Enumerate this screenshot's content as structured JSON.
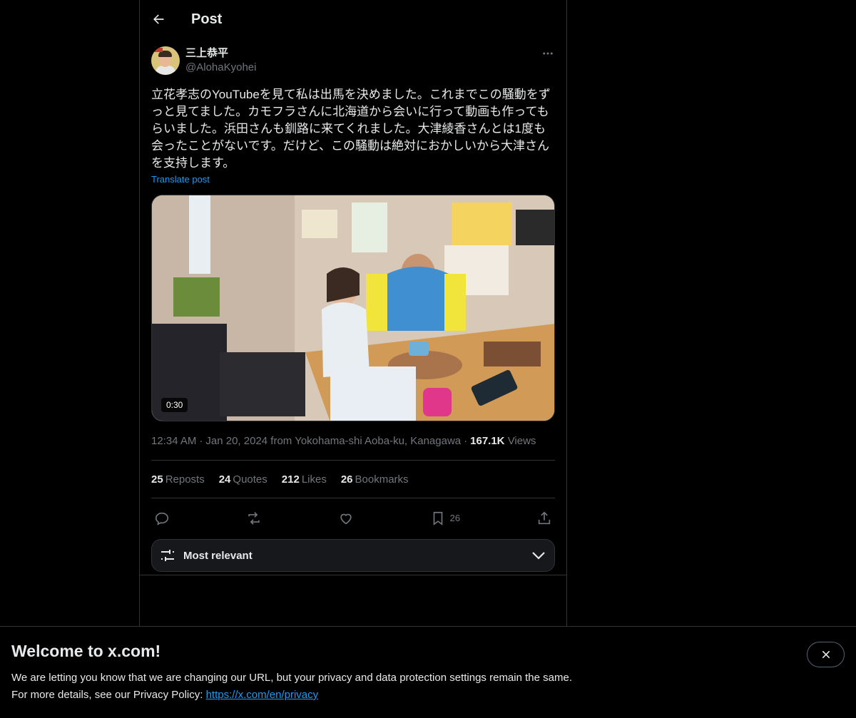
{
  "header": {
    "title": "Post"
  },
  "author": {
    "name": "三上恭平",
    "handle": "@AlohaKyohei"
  },
  "post": {
    "text": "立花孝志のYouTubeを見て私は出馬を決めました。これまでこの騒動をずっと見てました。カモフラさんに北海道から会いに行って動画も作ってもらいました。浜田さんも釧路に来てくれました。大津綾香さんとは1度も会ったことがないです。だけど、この騒動は絶対におかしいから大津さんを支持します。",
    "translate_label": "Translate post",
    "video_duration": "0:30",
    "time": "12:34 AM",
    "date_location": "Jan 20, 2024 from Yokohama-shi Aoba-ku, Kanagawa",
    "views_count": "167.1K",
    "views_label": "Views"
  },
  "stats": {
    "reposts": {
      "count": "25",
      "label": "Reposts"
    },
    "quotes": {
      "count": "24",
      "label": "Quotes"
    },
    "likes": {
      "count": "212",
      "label": "Likes"
    },
    "bookmarks": {
      "count": "26",
      "label": "Bookmarks"
    }
  },
  "actions": {
    "bookmark_count": "26"
  },
  "sort": {
    "label": "Most relevant"
  },
  "banner": {
    "title": "Welcome to x.com!",
    "line1": "We are letting you know that we are changing our URL, but your privacy and data protection settings remain the same.",
    "line2_prefix": "For more details, see our Privacy Policy: ",
    "link": "https://x.com/en/privacy"
  },
  "icons": {
    "back": "arrow-left-icon",
    "more": "more-icon",
    "reply": "reply-icon",
    "repost": "repost-icon",
    "like": "heart-icon",
    "bookmark": "bookmark-icon",
    "share": "share-icon",
    "sort": "sliders-icon",
    "chevron": "chevron-down-icon",
    "close": "close-icon"
  },
  "colors": {
    "background": "#000000",
    "accent": "#1d9bf0",
    "border": "#2f3336",
    "secondary_text": "#71767b"
  }
}
